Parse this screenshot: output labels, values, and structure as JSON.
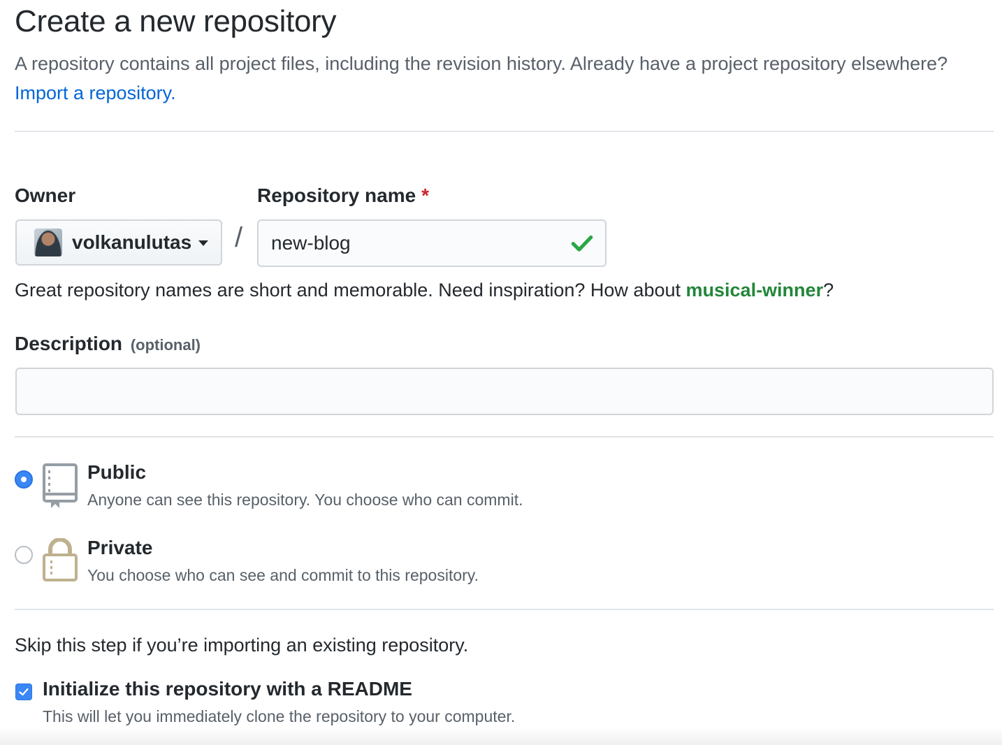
{
  "header": {
    "title": "Create a new repository",
    "subtitle": "A repository contains all project files, including the revision history. Already have a project repository elsewhere?",
    "import_link": "Import a repository."
  },
  "owner": {
    "label": "Owner",
    "selected": "volkanulutas",
    "avatar_icon": "user-avatar"
  },
  "separator": "/",
  "repo_name": {
    "label": "Repository name",
    "required_mark": "*",
    "value": "new-blog",
    "status_icon": "check-icon",
    "status_color": "#28a745"
  },
  "hint": {
    "text": "Great repository names are short and memorable. Need inspiration? How about",
    "suggestion": "musical-winner",
    "suffix": "?"
  },
  "description": {
    "label": "Description",
    "optional": "(optional)",
    "value": "",
    "placeholder": ""
  },
  "visibility": {
    "selected": "public",
    "options": [
      {
        "id": "public",
        "title": "Public",
        "description": "Anyone can see this repository. You choose who can commit.",
        "icon": "repo-book-icon",
        "icon_color": "#959da5"
      },
      {
        "id": "private",
        "title": "Private",
        "description": "You choose who can see and commit to this repository.",
        "icon": "lock-icon",
        "icon_color": "#bfb18f"
      }
    ]
  },
  "init": {
    "skip_text": "Skip this step if you’re importing an existing repository.",
    "readme_label": "Initialize this repository with a README",
    "readme_desc": "This will let you immediately clone the repository to your computer.",
    "readme_checked": true
  },
  "colors": {
    "link": "#0366d6",
    "accent_blue": "#3a87f5",
    "required_red": "#cb2431",
    "suggestion_green": "#22863a"
  }
}
